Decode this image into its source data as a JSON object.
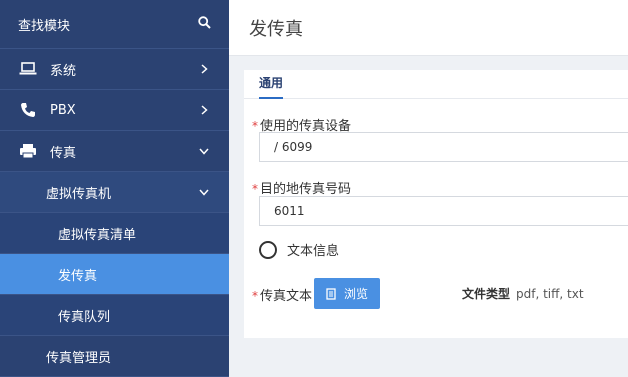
{
  "sidebar": {
    "search_label": "查找模块",
    "items": [
      {
        "label": "系统"
      },
      {
        "label": "PBX"
      },
      {
        "label": "传真"
      },
      {
        "label": "虚拟传真机"
      },
      {
        "label": "虚拟传真清单"
      },
      {
        "label": "发传真"
      },
      {
        "label": "传真队列"
      },
      {
        "label": "传真管理员"
      }
    ]
  },
  "page": {
    "title": "发传真",
    "tab": "通用"
  },
  "form": {
    "device_label": "使用的传真设备",
    "device_value": "/ 6099",
    "dest_label": "目的地传真号码",
    "dest_value": "6011",
    "text_info_label": "文本信息",
    "fax_text_label": "传真文本",
    "browse_label": "浏览",
    "file_type_label": "文件类型",
    "file_type_value": "pdf, tiff, txt"
  },
  "colors": {
    "sidebar": "#2b4272",
    "active": "#4a90e2",
    "required": "#e04040"
  }
}
